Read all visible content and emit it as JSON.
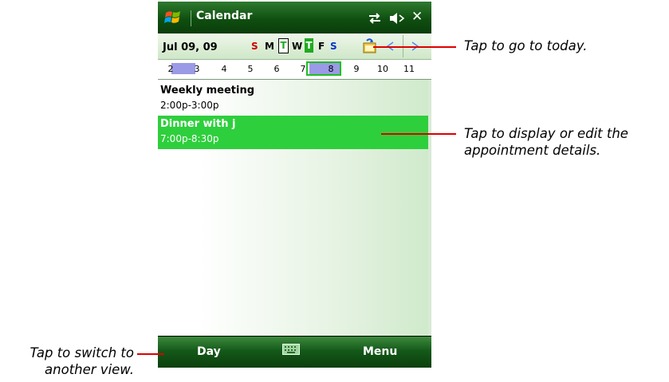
{
  "titlebar": {
    "title": "Calendar",
    "close_label": "✕"
  },
  "datebar": {
    "date": "Jul 09, 09",
    "week_letters": [
      {
        "letter": "S",
        "kind": "sun"
      },
      {
        "letter": "M",
        "kind": "norm"
      },
      {
        "letter": "T",
        "kind": "today"
      },
      {
        "letter": "W",
        "kind": "norm"
      },
      {
        "letter": "T",
        "kind": "sel"
      },
      {
        "letter": "F",
        "kind": "norm"
      },
      {
        "letter": "S",
        "kind": "sat"
      }
    ]
  },
  "weekstrip": {
    "dates": [
      "2",
      "3",
      "4",
      "5",
      "6",
      "7",
      "8",
      "9",
      "10",
      "11"
    ]
  },
  "appointments": [
    {
      "title": "Weekly meeting",
      "time": "2:00p-3:00p"
    },
    {
      "title": "Dinner with j",
      "time": "7:00p-8:30p"
    }
  ],
  "softkeys": {
    "left": "Day",
    "right": "Menu"
  },
  "callouts": {
    "today": "Tap to go to today.",
    "details_line1": "Tap to display or edit the",
    "details_line2": "appointment details.",
    "switch_line1": "Tap to switch to",
    "switch_line2": "another view."
  },
  "colors": {
    "accent_green": "#2ecf3c",
    "callout_line": "#dd0000",
    "sunday": "#cc0000",
    "saturday": "#0033cc"
  }
}
